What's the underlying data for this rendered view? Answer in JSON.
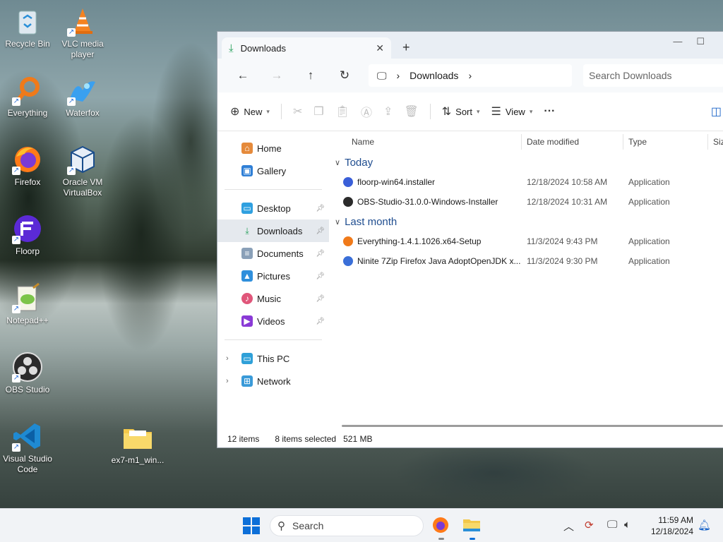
{
  "desktop": {
    "icons": [
      {
        "label": "Recycle Bin"
      },
      {
        "label": "VLC media player"
      },
      {
        "label": "Everything"
      },
      {
        "label": "Waterfox"
      },
      {
        "label": "Firefox"
      },
      {
        "label": "Oracle VM VirtualBox"
      },
      {
        "label": "Floorp"
      },
      {
        "label": "Notepad++"
      },
      {
        "label": "OBS Studio"
      },
      {
        "label": "Visual Studio Code"
      },
      {
        "label": "ex7-m1_win..."
      }
    ]
  },
  "explorer": {
    "tab_title": "Downloads",
    "tab_close": "✕",
    "new_tab": "+",
    "breadcrumb": {
      "current": "Downloads"
    },
    "search_placeholder": "Search Downloads",
    "toolbar": {
      "new_label": "New",
      "sort_label": "Sort",
      "view_label": "View",
      "more_label": "···"
    },
    "nav": {
      "quick": [
        {
          "label": "Home"
        },
        {
          "label": "Gallery"
        }
      ],
      "pinned": [
        {
          "label": "Desktop"
        },
        {
          "label": "Downloads"
        },
        {
          "label": "Documents"
        },
        {
          "label": "Pictures"
        },
        {
          "label": "Music"
        },
        {
          "label": "Videos"
        }
      ],
      "tree": [
        {
          "label": "This PC"
        },
        {
          "label": "Network"
        }
      ]
    },
    "columns": {
      "name": "Name",
      "date": "Date modified",
      "type": "Type",
      "size": "Siz"
    },
    "groups": [
      {
        "label": "Today",
        "files": [
          {
            "name": "floorp-win64.installer",
            "date": "12/18/2024 10:58 AM",
            "type": "Application"
          },
          {
            "name": "OBS-Studio-31.0.0-Windows-Installer",
            "date": "12/18/2024 10:31 AM",
            "type": "Application"
          }
        ]
      },
      {
        "label": "Last month",
        "files": [
          {
            "name": "Everything-1.4.1.1026.x64-Setup",
            "date": "11/3/2024 9:43 PM",
            "type": "Application"
          },
          {
            "name": "Ninite 7Zip Firefox Java AdoptOpenJDK x...",
            "date": "11/3/2024 9:30 PM",
            "type": "Application"
          }
        ]
      }
    ],
    "status": {
      "items": "12 items",
      "selected": "8 items selected",
      "size": "521 MB"
    }
  },
  "taskbar": {
    "search_placeholder": "Search",
    "time": "11:59 AM",
    "date": "12/18/2024"
  },
  "colors": {
    "accent": "#0d6fd8",
    "group_heading": "#1f4d8f",
    "selected_nav": "#e5e9ee"
  }
}
